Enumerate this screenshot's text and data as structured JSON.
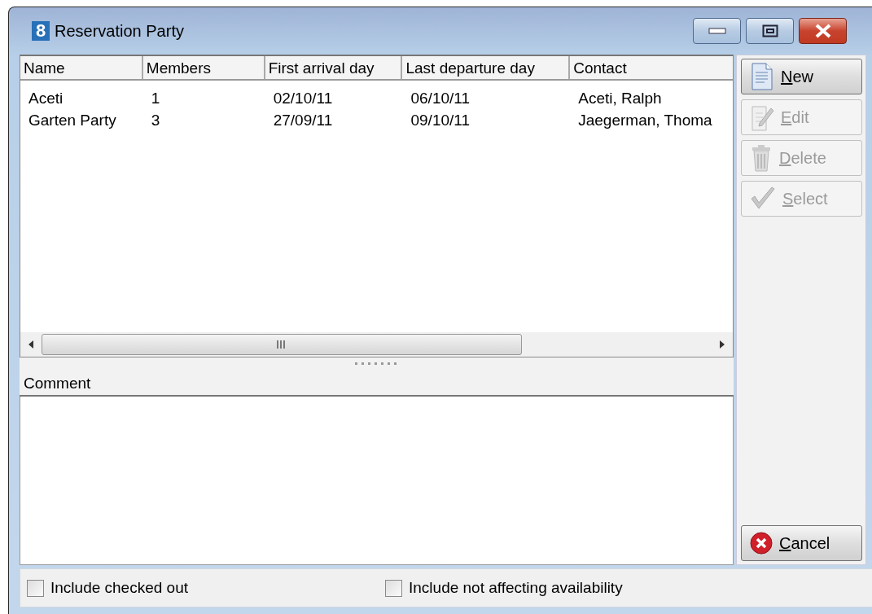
{
  "window": {
    "logo": "8",
    "title": "Reservation Party"
  },
  "table": {
    "columns": [
      "Name",
      "Members",
      "First arrival day",
      "Last departure day",
      "Contact"
    ],
    "rows": [
      {
        "cells": [
          "Aceti",
          "1",
          "02/10/11",
          "06/10/11",
          "Aceti, Ralph"
        ]
      },
      {
        "cells": [
          "Garten Party",
          "3",
          "27/09/11",
          "09/10/11",
          "Jaegerman, Thoma"
        ]
      }
    ]
  },
  "comment": {
    "label": "Comment"
  },
  "buttons": [
    {
      "kind": "new",
      "label": "New",
      "disabled": false
    },
    {
      "kind": "edit",
      "label": "Edit",
      "disabled": true
    },
    {
      "kind": "delete",
      "label": "Delete",
      "disabled": true
    },
    {
      "kind": "select",
      "label": "Select",
      "disabled": true
    }
  ],
  "cancel_button": {
    "label": "Cancel"
  },
  "options": [
    {
      "label": "Include checked out",
      "checked": false
    },
    {
      "label": "Include not affecting availability",
      "checked": false
    }
  ]
}
